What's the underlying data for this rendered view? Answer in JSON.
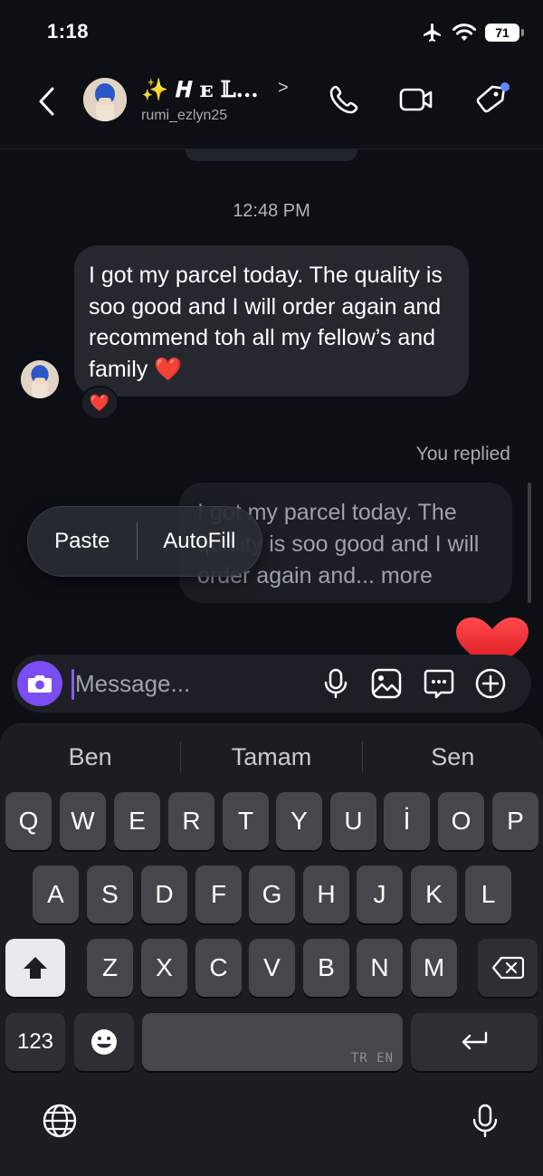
{
  "status_bar": {
    "time": "1:18",
    "battery": "71",
    "icons": [
      "airplane-icon",
      "wifi-icon",
      "battery-icon"
    ]
  },
  "header": {
    "name": "✨ 𝑯 ᴇ 𝕃...",
    "chevron": ">",
    "username": "rumi_ezlyn25",
    "icons": [
      "back-icon",
      "phone-icon",
      "video-icon",
      "tag-icon"
    ],
    "notification_dot_color": "#5b8cff"
  },
  "conversation": {
    "timestamp": "12:48 PM",
    "incoming_message": "I got my parcel today. The quality is soo good and I will order again and recommend toh all my fellow’s and family ❤️",
    "reaction": "❤️",
    "replied_label": "You replied",
    "reply_preview": "I got my parcel today. The quality is soo good and I will order again and... more"
  },
  "context_menu": {
    "paste": "Paste",
    "autofill": "AutoFill"
  },
  "composer": {
    "placeholder": "Message...",
    "icons": [
      "camera-icon",
      "microphone-icon",
      "gallery-icon",
      "sticker-icon",
      "plus-icon"
    ],
    "camera_color": "#7a4ef2"
  },
  "keyboard": {
    "suggestions": [
      "Ben",
      "Tamam",
      "Sen"
    ],
    "row1": [
      "Q",
      "W",
      "E",
      "R",
      "T",
      "Y",
      "U",
      "İ",
      "O",
      "P"
    ],
    "row2": [
      "A",
      "S",
      "D",
      "F",
      "G",
      "H",
      "J",
      "K",
      "L"
    ],
    "row3": [
      "Z",
      "X",
      "C",
      "V",
      "B",
      "N",
      "M"
    ],
    "numbers_key": "123",
    "space_lang": "TR EN",
    "icons": [
      "shift-icon",
      "backspace-icon",
      "emoji-icon",
      "return-icon",
      "globe-icon",
      "dictation-icon"
    ]
  }
}
